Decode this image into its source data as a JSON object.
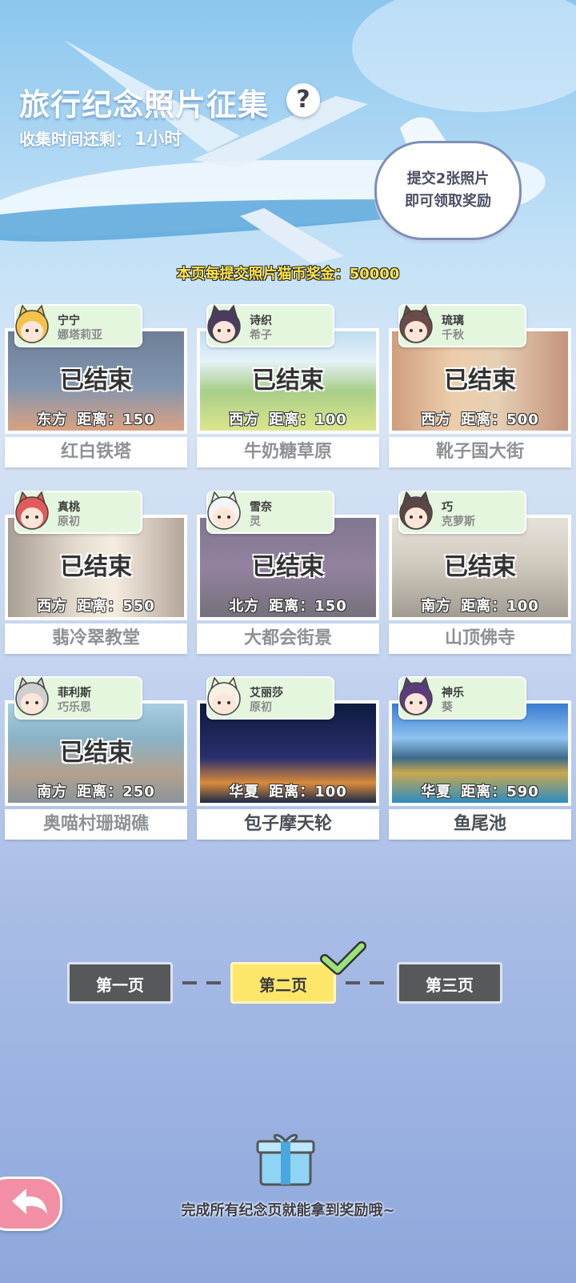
{
  "header": {
    "title": "旅行纪念照片征集",
    "help": "?",
    "timer_label": "收集时间还剩：",
    "timer_value": "1小时",
    "bubble_line1": "提交2张照片",
    "bubble_line2": "即可领取奖励",
    "bonus": "本页每提交照片猫币奖金：50000"
  },
  "cards": [
    {
      "name1": "宁宁",
      "name2": "娜塔莉亚",
      "ended": "已结束",
      "dir": "东方",
      "dist": "距离：150",
      "place": "红白铁塔",
      "hair": "#f2c24a"
    },
    {
      "name1": "诗织",
      "name2": "希子",
      "ended": "已结束",
      "dir": "西方",
      "dist": "距离：100",
      "place": "牛奶糖草原",
      "hair": "#4a3b5f"
    },
    {
      "name1": "琉璃",
      "name2": "千秋",
      "ended": "已结束",
      "dir": "西方",
      "dist": "距离：500",
      "place": "靴子国大街",
      "hair": "#6b4a4a"
    },
    {
      "name1": "真桃",
      "name2": "原初",
      "ended": "已结束",
      "dir": "西方",
      "dist": "距离：550",
      "place": "翡冷翠教堂",
      "hair": "#e35a5a"
    },
    {
      "name1": "雪奈",
      "name2": "灵",
      "ended": "已结束",
      "dir": "北方",
      "dist": "距离：150",
      "place": "大都会街景",
      "hair": "#f4f4f4"
    },
    {
      "name1": "巧",
      "name2": "克萝斯",
      "ended": "已结束",
      "dir": "南方",
      "dist": "距离：100",
      "place": "山顶佛寺",
      "hair": "#5a4646"
    },
    {
      "name1": "菲利斯",
      "name2": "巧乐思",
      "ended": "已结束",
      "dir": "南方",
      "dist": "距离：250",
      "place": "奥喵村珊瑚礁",
      "hair": "#cfcfcf"
    },
    {
      "name1": "艾丽莎",
      "name2": "原初",
      "ended": "",
      "dir": "华夏",
      "dist": "距离：100",
      "place": "包子摩天轮",
      "hair": "#f5f1e6"
    },
    {
      "name1": "神乐",
      "name2": "葵",
      "ended": "",
      "dir": "华夏",
      "dist": "距离：590",
      "place": "鱼尾池",
      "hair": "#5b3d7a"
    }
  ],
  "pager": {
    "p1": "第一页",
    "p2": "第二页",
    "p3": "第三页"
  },
  "footer": {
    "goal": "完成所有纪念页就能拿到奖励哦~"
  }
}
